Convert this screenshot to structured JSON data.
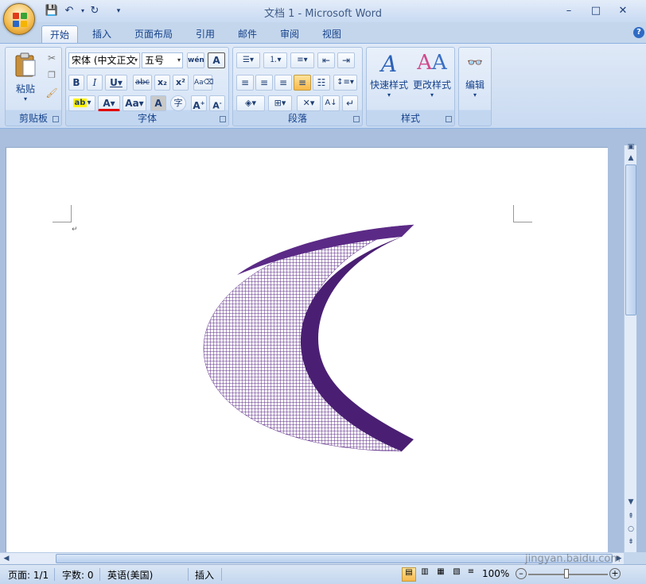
{
  "window": {
    "title": "文档 1 - Microsoft Word"
  },
  "tabs": [
    "开始",
    "插入",
    "页面布局",
    "引用",
    "邮件",
    "审阅",
    "视图"
  ],
  "ribbon": {
    "clipboard": {
      "label": "剪贴板",
      "paste": "粘贴"
    },
    "font": {
      "label": "字体",
      "font_name": "宋体 (中文正文",
      "font_size": "五号"
    },
    "paragraph": {
      "label": "段落"
    },
    "styles": {
      "label": "样式",
      "quick_styles": "快速样式",
      "change_styles": "更改样式"
    },
    "editing": {
      "label": "编辑"
    }
  },
  "status": {
    "page": "页面: 1/1",
    "words": "字数: 0",
    "language": "英语(美国)",
    "mode": "插入",
    "zoom": "100%"
  },
  "watermark": "jingyan.baidu.com",
  "colors": {
    "shape": "#5b2a86",
    "shape_dark": "#4a1f73",
    "highlight": "#fff200",
    "font_color": "#e00000"
  }
}
